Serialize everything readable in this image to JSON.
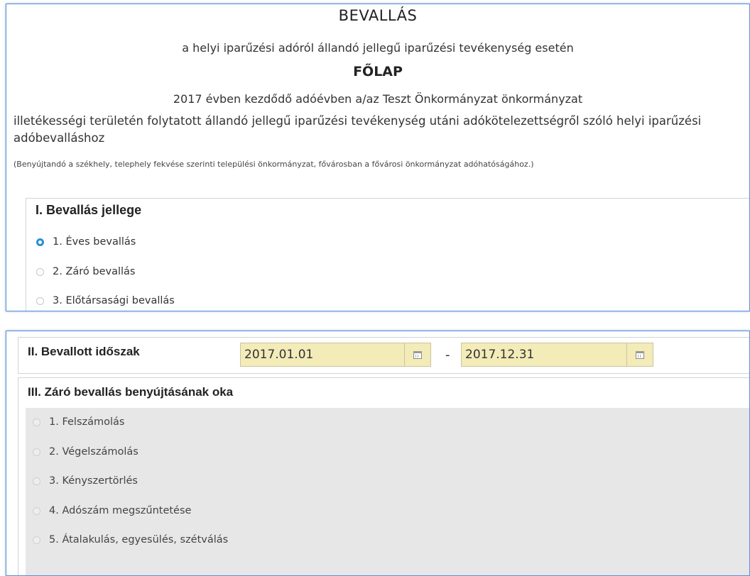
{
  "header": {
    "title": "BEVALLÁS",
    "subtitle": "a helyi iparűzési adóról állandó jellegű iparűzési tevékenység esetén",
    "sheet": "FŐLAP",
    "year_line": "2017 évben kezdődő adóévben a/az Teszt Önkormányzat önkormányzat",
    "description": "illetékességi területén folytatott állandó jellegű iparűzési tevékenység utáni adókötelezettségről szóló helyi iparűzési adóbevalláshoz",
    "note": "(Benyújtandó a székhely, telephely fekvése szerinti települési önkormányzat, fővárosban a fővárosi önkormányzat adóhatóságához.)"
  },
  "section1": {
    "title": "I. Bevallás jellege",
    "options": [
      {
        "label": "1. Éves bevallás",
        "checked": true
      },
      {
        "label": "2. Záró bevallás",
        "checked": false
      },
      {
        "label": "3. Előtársasági bevallás",
        "checked": false
      }
    ]
  },
  "section2": {
    "title": "II. Bevallott időszak",
    "from": "2017.01.01",
    "to": "2017.12.31",
    "separator": "-",
    "calendar_icon": "calendar-icon"
  },
  "section3": {
    "title": "III. Záró bevallás benyújtásának oka",
    "options": [
      {
        "label": "1. Felszámolás",
        "checked": false
      },
      {
        "label": "2. Végelszámolás",
        "checked": false
      },
      {
        "label": "3. Kényszertörlés",
        "checked": false
      },
      {
        "label": "4. Adószám megszűntetése",
        "checked": false
      },
      {
        "label": "5. Átalakulás, egyesülés, szétválás",
        "checked": false
      }
    ]
  },
  "colors": {
    "accent": "#2a8fd6",
    "panel_border": "#5b8fd6",
    "date_field": "#f3ebb8",
    "disabled_area": "#e7e7e7"
  }
}
